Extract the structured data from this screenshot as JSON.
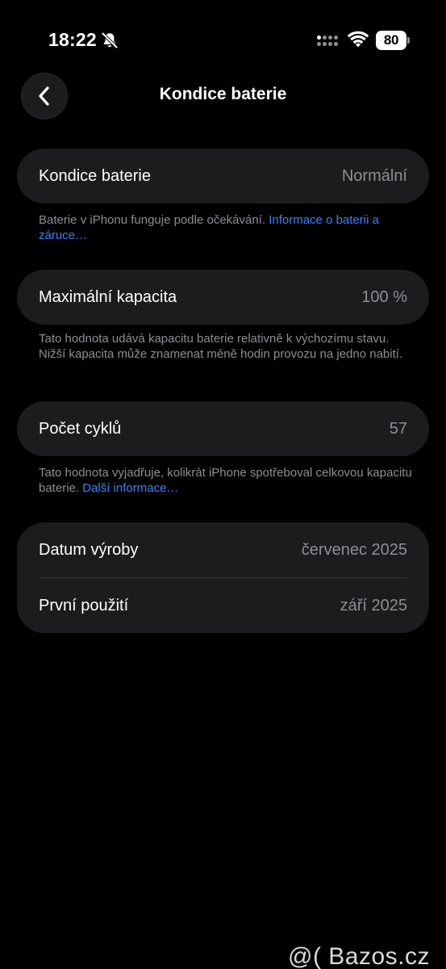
{
  "status_bar": {
    "time": "18:22",
    "battery_level": "80",
    "icons": [
      "bell-slash-icon",
      "cellular-signal-icon",
      "wifi-icon",
      "battery-icon"
    ]
  },
  "nav": {
    "title": "Kondice baterie",
    "back_icon": "chevron-left-icon"
  },
  "sections": {
    "health": {
      "label": "Kondice baterie",
      "value": "Normální",
      "footnote_text": "Baterie v iPhonu funguje podle očekávání. ",
      "footnote_link": "Informace o baterii a záruce…"
    },
    "capacity": {
      "label": "Maximální kapacita",
      "value": "100 %",
      "footnote_text": "Tato hodnota udává kapacitu baterie relativně k výchozímu stavu. Nižší kapacita může znamenat méně hodin provozu na jedno nabití."
    },
    "cycles": {
      "label": "Počet cyklů",
      "value": "57",
      "footnote_text": "Tato hodnota vyjadřuje, kolikrát iPhone spotřeboval celkovou kapacitu baterie. ",
      "footnote_link": "Další informace…"
    },
    "dates": {
      "manufacture_label": "Datum výroby",
      "manufacture_value": "červenec 2025",
      "first_use_label": "První použití",
      "first_use_value": "září 2025"
    }
  },
  "watermark": "@( Bazos.cz",
  "colors": {
    "background": "#000000",
    "card": "#1c1c1e",
    "secondary_text": "#8e8e93",
    "link": "#3a82f7",
    "separator": "#38383a"
  }
}
